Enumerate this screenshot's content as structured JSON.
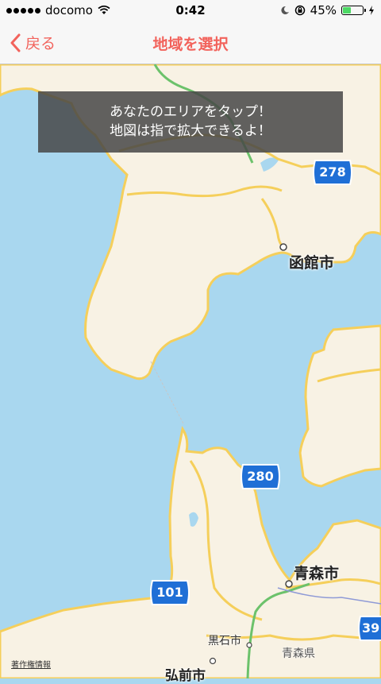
{
  "status_bar": {
    "carrier": "docomo",
    "time": "0:42",
    "battery": "45%",
    "battery_level": 0.45
  },
  "nav": {
    "back_label": "戻る",
    "title": "地域を選択"
  },
  "overlay": {
    "line1": "あなたのエリアをタップ！",
    "line2": "地図は指で拡大できるよ！"
  },
  "map": {
    "cities": {
      "hakodate": "函館市",
      "aomori_city": "青森市",
      "kuroishi": "黒石市",
      "hirosaki": "弘前市",
      "aomori_pref": "青森県"
    },
    "routes": [
      "278",
      "280",
      "101",
      "39"
    ],
    "legal": "著作権情報"
  },
  "colors": {
    "accent": "#f2635c",
    "water": "#a9d7ef",
    "land": "#f8f2e4",
    "road": "#f5cf5b",
    "shield": "#1f6fd6"
  }
}
